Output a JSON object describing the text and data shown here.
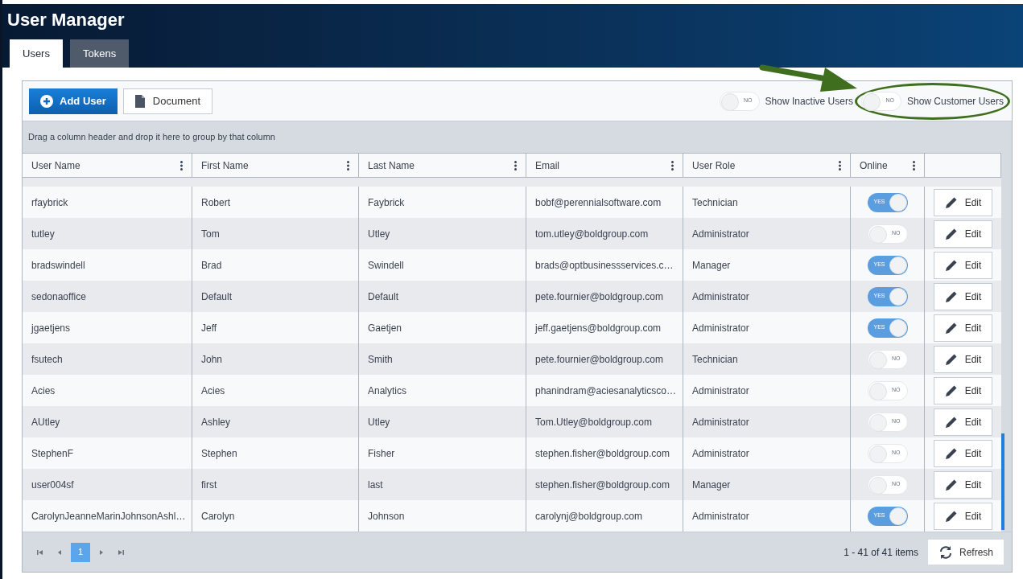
{
  "window": {
    "title": "User Manager"
  },
  "tabs": [
    {
      "label": "Users",
      "selected": true
    },
    {
      "label": "Tokens",
      "selected": false
    }
  ],
  "toolbar": {
    "buttons": [
      {
        "label": "Add User",
        "kind": "primary"
      },
      {
        "label": "Document",
        "kind": "secondary"
      }
    ],
    "toggles": [
      {
        "label": "Show Inactive Users",
        "on": false,
        "state_text": "NO",
        "highlighted": false
      },
      {
        "label": "Show Customer Users",
        "on": false,
        "state_text": "NO",
        "highlighted": true
      }
    ]
  },
  "group_hint": "Drag a column header and drop it here to group by that column",
  "table": {
    "columns": [
      "User Name",
      "First Name",
      "Last Name",
      "Email",
      "User Role",
      "Online"
    ],
    "rows": [
      {
        "user_name": "rfaybrick",
        "first_name": "Robert",
        "last_name": "Faybrick",
        "email": "bobf@perennialsoftware.com",
        "role": "Technician",
        "online": true,
        "online_text": "YES",
        "action": "Edit"
      },
      {
        "user_name": "tutley",
        "first_name": "Tom",
        "last_name": "Utley",
        "email": "tom.utley@boldgroup.com",
        "role": "Administrator",
        "online": false,
        "online_text": "NO",
        "action": "Edit"
      },
      {
        "user_name": "bradswindell",
        "first_name": "Brad",
        "last_name": "Swindell",
        "email": "brads@optbusinessservices.c…",
        "role": "Manager",
        "online": true,
        "online_text": "YES",
        "action": "Edit"
      },
      {
        "user_name": "sedonaoffice",
        "first_name": "Default",
        "last_name": "Default",
        "email": "pete.fournier@boldgroup.com",
        "role": "Administrator",
        "online": true,
        "online_text": "YES",
        "action": "Edit"
      },
      {
        "user_name": "jgaetjens",
        "first_name": "Jeff",
        "last_name": "Gaetjen",
        "email": "jeff.gaetjens@boldgroup.com",
        "role": "Administrator",
        "online": true,
        "online_text": "YES",
        "action": "Edit"
      },
      {
        "user_name": "fsutech",
        "first_name": "John",
        "last_name": "Smith",
        "email": "pete.fournier@boldgroup.com",
        "role": "Technician",
        "online": false,
        "online_text": "NO",
        "action": "Edit"
      },
      {
        "user_name": "Acies",
        "first_name": "Acies",
        "last_name": "Analytics",
        "email": "phanindram@aciesanalyticsco…",
        "role": "Administrator",
        "online": false,
        "online_text": "NO",
        "action": "Edit"
      },
      {
        "user_name": "AUtley",
        "first_name": "Ashley",
        "last_name": "Utley",
        "email": "Tom.Utley@boldgroup.com",
        "role": "Administrator",
        "online": false,
        "online_text": "NO",
        "action": "Edit"
      },
      {
        "user_name": "StephenF",
        "first_name": "Stephen",
        "last_name": "Fisher",
        "email": "stephen.fisher@boldgroup.com",
        "role": "Administrator",
        "online": false,
        "online_text": "NO",
        "action": "Edit"
      },
      {
        "user_name": "user004sf",
        "first_name": "first",
        "last_name": "last",
        "email": "stephen.fisher@boldgroup.com",
        "role": "Manager",
        "online": false,
        "online_text": "NO",
        "action": "Edit"
      },
      {
        "user_name": "CarolynJeanneMarinJohnsonAshl…",
        "first_name": "Carolyn",
        "last_name": "Johnson",
        "email": "carolynj@boldgroup.com",
        "role": "Administrator",
        "online": true,
        "online_text": "YES",
        "action": "Edit"
      }
    ]
  },
  "pager": {
    "pages": [
      {
        "label": "1",
        "selected": true
      }
    ],
    "summary": "1 - 41 of 41 items",
    "refresh": "Refresh"
  }
}
